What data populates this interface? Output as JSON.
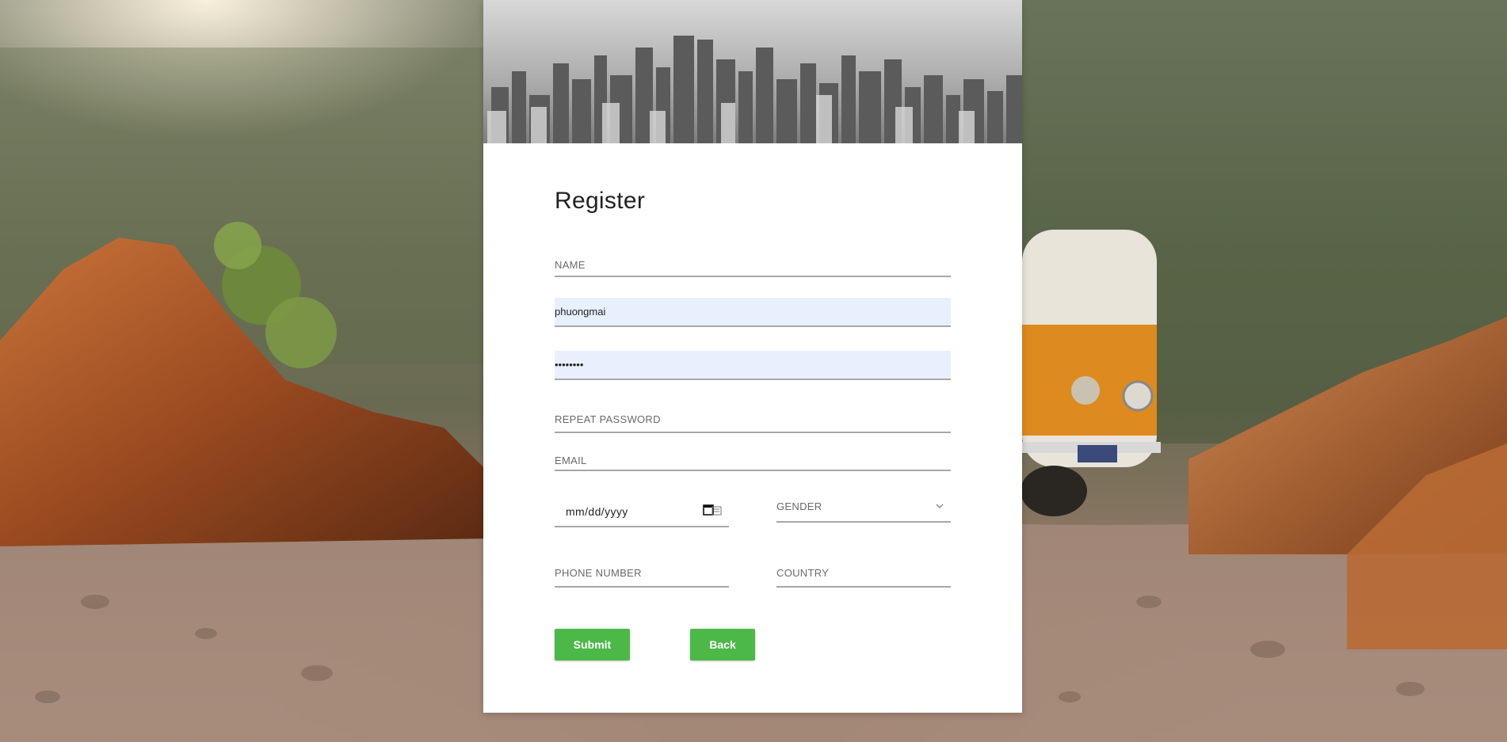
{
  "form": {
    "title": "Register",
    "name_placeholder": "NAME",
    "username_value": "phuongmai",
    "password_value": "password",
    "repeat_password_placeholder": "REPEAT PASSWORD",
    "email_placeholder": "EMAIL",
    "date_placeholder": "mm/dd/yyyy",
    "gender_label": "GENDER",
    "phone_placeholder": "PHONE NUMBER",
    "country_placeholder": "COUNTRY",
    "submit_label": "Submit",
    "back_label": "Back"
  },
  "icons": {
    "calendar": "calendar-icon",
    "gender_dropdown": "chevron-down-icon"
  },
  "colors": {
    "button": "#4cb848",
    "autofill": "#e8f0fe"
  }
}
